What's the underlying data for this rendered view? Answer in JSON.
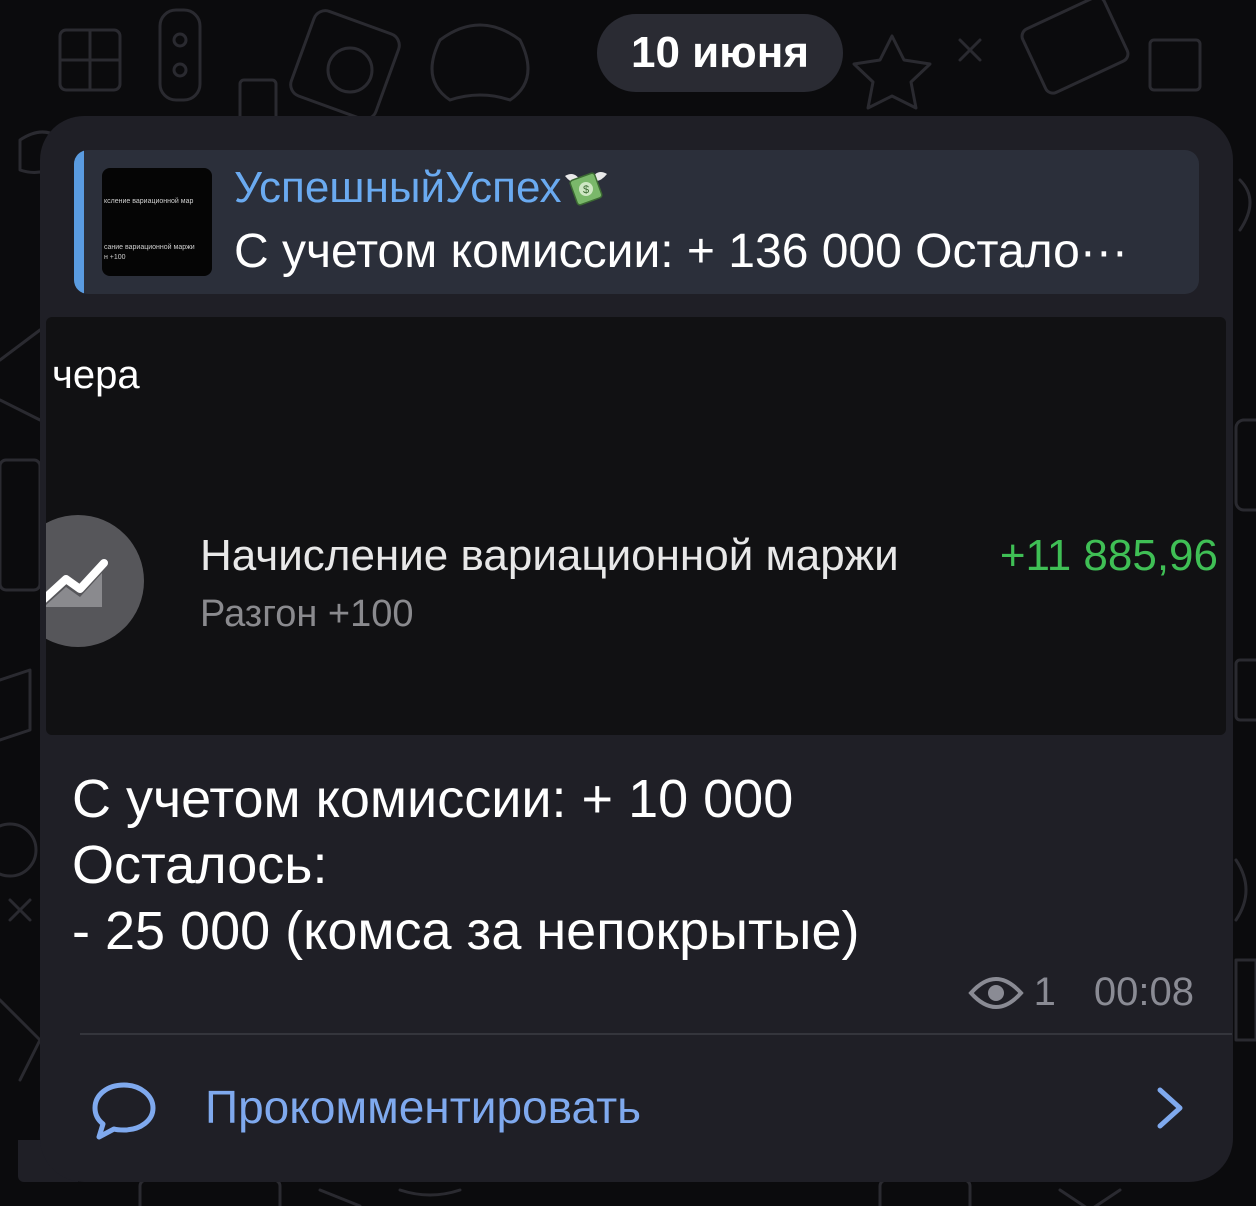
{
  "date_separator": "10 июня",
  "colors": {
    "background": "#0b0b0d",
    "bubble": "#1f1f26",
    "accent": "#7fa9ee",
    "reply_bar": "#5a9be0",
    "amount_positive": "#3fbf55"
  },
  "reply": {
    "author": "УспешныйУспех",
    "author_emoji": "money-with-wings-icon",
    "preview": "С учетом комиссии: + 136 000 Остало···",
    "thumbnail_lines": [
      "ксление вариационной мар",
      "сание вариационной маржи",
      "н +100"
    ]
  },
  "photo": {
    "date_label": "чера",
    "operation": {
      "icon": "trending-chart-icon",
      "title": "Начисление вариационной маржи",
      "subtitle": "Разгон +100",
      "amount": "+11 885,96"
    }
  },
  "message": {
    "lines": [
      "С учетом комиссии: + 10 000",
      "Осталось:",
      "- 25 000 (комса за непокрытые)"
    ],
    "views": "1",
    "time": "00:08"
  },
  "comments": {
    "label": "Прокомментировать",
    "icon": "speech-bubble-icon",
    "chevron": "chevron-right-icon"
  }
}
